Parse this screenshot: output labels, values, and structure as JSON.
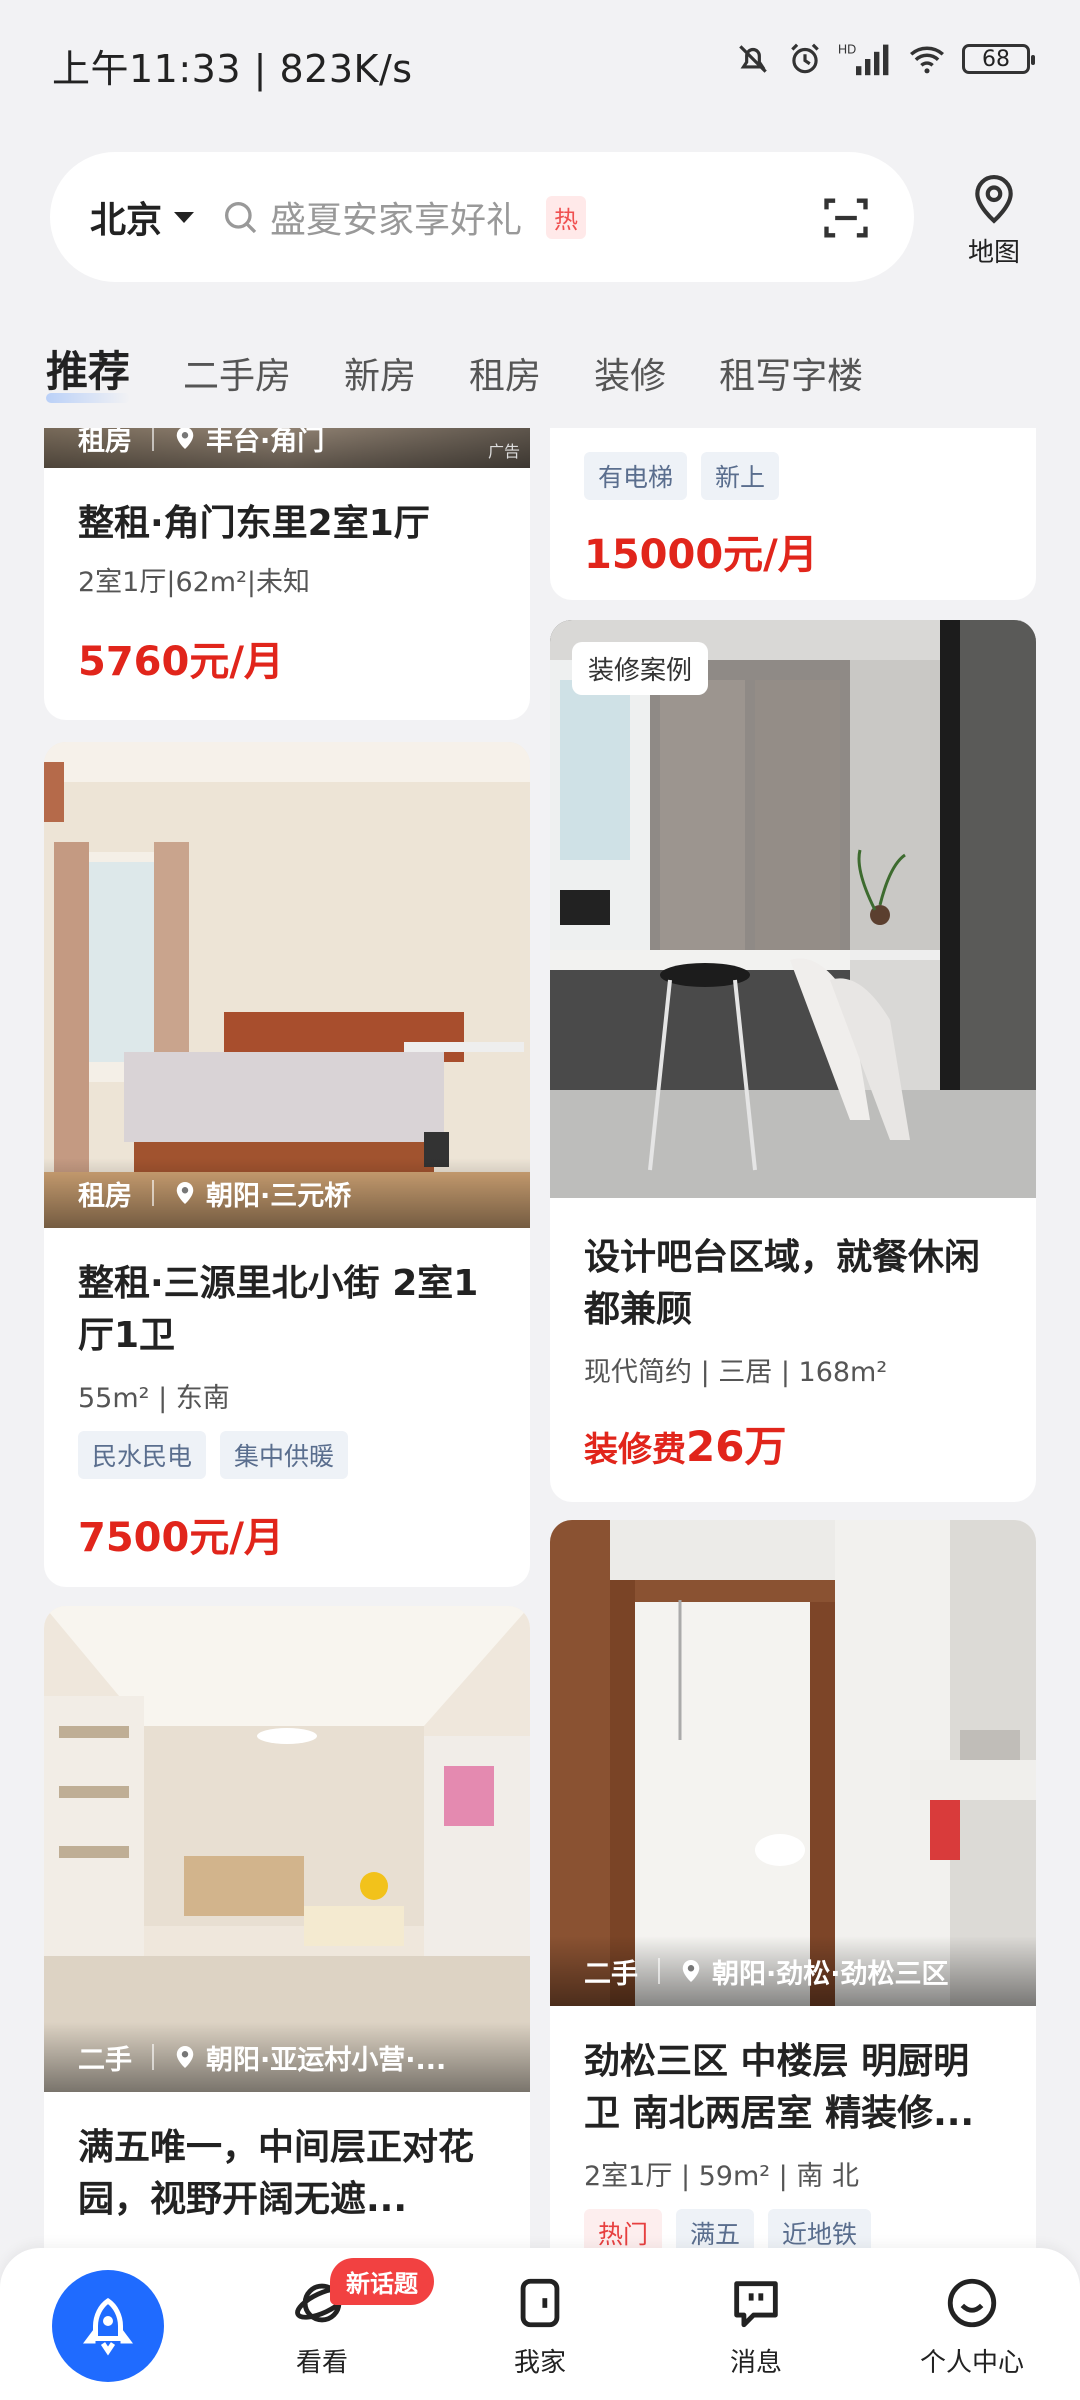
{
  "status": {
    "time": "上午11:33",
    "speed": "823K/s",
    "battery": "68",
    "network": "HD"
  },
  "search": {
    "city": "北京",
    "placeholder": "盛夏安家享好礼",
    "hot": "热",
    "map_label": "地图"
  },
  "tabs": [
    "推荐",
    "二手房",
    "新房",
    "租房",
    "装修",
    "租写字楼"
  ],
  "cards": {
    "c1": {
      "overlay_type": "租房",
      "overlay_loc": "丰台·角门",
      "ad": "广告",
      "title": "整租·角门东里2室1厅",
      "meta": "2室1厅|62m²|未知",
      "price": "5760元/月"
    },
    "c2": {
      "tags": [
        "有电梯",
        "新上"
      ],
      "price": "15000元/月"
    },
    "c3": {
      "overlay_type": "租房",
      "overlay_loc": "朝阳·三元桥",
      "title": "整租·三源里北小街 2室1厅1卫",
      "meta": "55m² | 东南",
      "tags": [
        "民水民电",
        "集中供暖"
      ],
      "price": "7500元/月"
    },
    "c4": {
      "badge": "装修案例",
      "title": "设计吧台区域，就餐休闲都兼顾",
      "meta": "现代简约 | 三居 | 168m²",
      "price_label": "装修费",
      "price_value": "26万"
    },
    "c5": {
      "overlay_type": "二手",
      "overlay_loc": "朝阳·亚运村小营·...",
      "title": "满五唯一，中间层正对花园，视野开阔无遮..."
    },
    "c6": {
      "overlay_type": "二手",
      "overlay_loc": "朝阳·劲松·劲松三区",
      "title": "劲松三区 中楼层 明厨明卫 南北两居室 精装修...",
      "meta": "2室1厅 | 59m² | 南 北",
      "tags": [
        "热门",
        "满五",
        "近地铁"
      ]
    }
  },
  "nav": {
    "items": [
      "看看",
      "我家",
      "消息",
      "个人中心"
    ],
    "new_badge": "新话题"
  },
  "colors": {
    "accent": "#1f6bff",
    "price": "#e1251b"
  }
}
